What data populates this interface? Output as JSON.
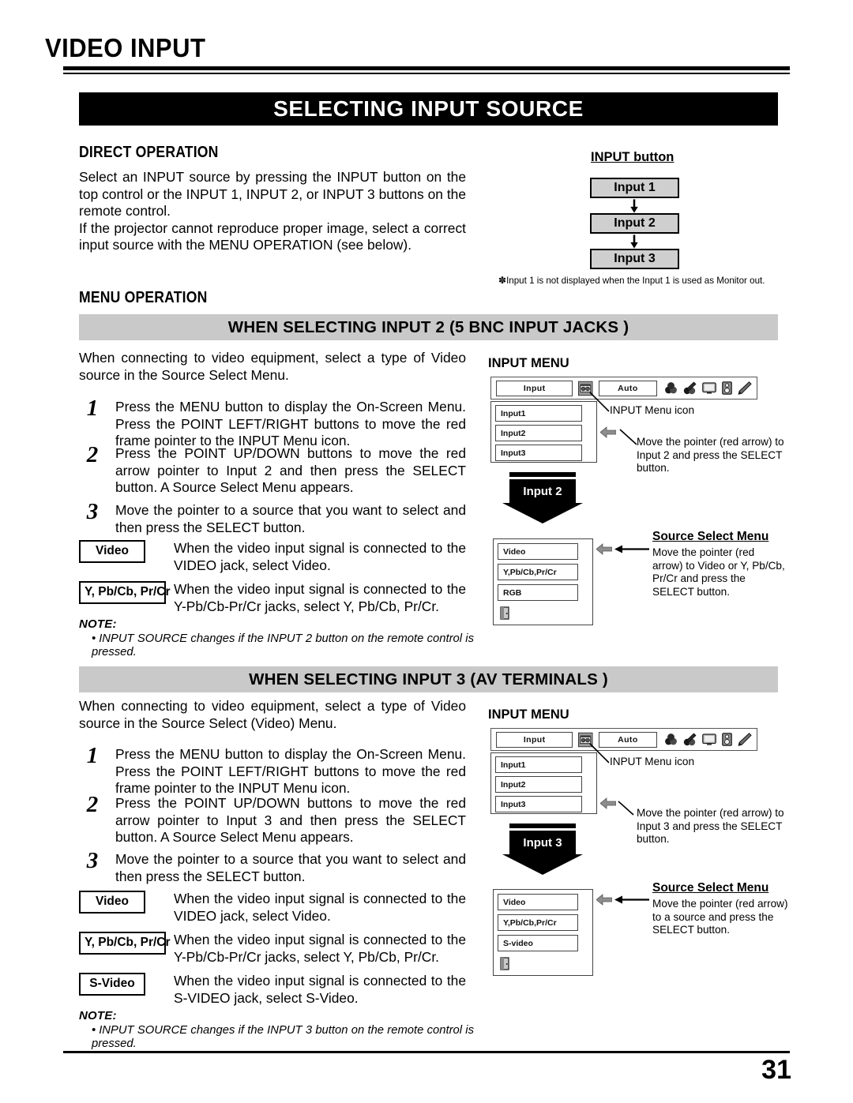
{
  "page": {
    "title": "VIDEO INPUT",
    "banner": "SELECTING INPUT SOURCE",
    "number": "31"
  },
  "direct_operation": {
    "heading": "DIRECT OPERATION",
    "paragraph1": "Select an INPUT source by pressing the INPUT button on the top control or the INPUT 1, INPUT 2, or INPUT 3 buttons on the remote control.",
    "paragraph2": "If the projector cannot reproduce proper image, select a correct input source with the MENU OPERATION (see below)."
  },
  "input_button_diagram": {
    "label": "INPUT button",
    "buttons": [
      "Input 1",
      "Input 2",
      "Input 3"
    ],
    "footnote_mark": "✽",
    "footnote": "Input 1 is not displayed when the Input 1 is used as Monitor out."
  },
  "menu_operation": {
    "heading": "MENU OPERATION"
  },
  "section_input2": {
    "bar": "WHEN SELECTING INPUT 2 (5 BNC INPUT JACKS )",
    "intro": "When connecting to video equipment, select a type of Video source in the Source Select Menu.",
    "steps": [
      {
        "num": "1",
        "text": "Press the MENU button to display the On-Screen Menu. Press the POINT LEFT/RIGHT buttons to move the red frame pointer to the INPUT Menu icon."
      },
      {
        "num": "2",
        "text": "Press the POINT UP/DOWN buttons to move the red arrow pointer to Input 2 and then press the SELECT button. A Source Select Menu appears."
      },
      {
        "num": "3",
        "text": "Move the pointer to a source that you want to select and then press the SELECT button."
      }
    ],
    "definitions": [
      {
        "key": "Video",
        "desc": "When the video input signal is connected to the VIDEO jack, select Video."
      },
      {
        "key": "Y, Pb/Cb, Pr/Cr",
        "desc": "When the video input signal is connected to the Y-Pb/Cb-Pr/Cr jacks, select Y, Pb/Cb, Pr/Cr."
      }
    ],
    "note_heading": "NOTE:",
    "note_text": "INPUT SOURCE changes if the INPUT 2 button on the remote control is pressed."
  },
  "section_input3": {
    "bar": "WHEN SELECTING INPUT 3 (AV TERMINALS )",
    "intro": "When connecting to video equipment, select a type of Video source in the Source Select (Video) Menu.",
    "steps": [
      {
        "num": "1",
        "text": "Press the MENU button to display the On-Screen Menu. Press the POINT LEFT/RIGHT buttons to move the red frame pointer to the INPUT Menu icon."
      },
      {
        "num": "2",
        "text": "Press the POINT UP/DOWN buttons to move the red arrow pointer to Input 3 and then press the SELECT button. A Source Select Menu appears."
      },
      {
        "num": "3",
        "text": "Move the pointer to a source that you want to select and then press the SELECT button."
      }
    ],
    "definitions": [
      {
        "key": "Video",
        "desc": "When the video input signal is connected to the VIDEO jack, select Video."
      },
      {
        "key": "Y, Pb/Cb, Pr/Cr",
        "desc": "When the video input signal is connected to the Y-Pb/Cb-Pr/Cr jacks, select Y, Pb/Cb, Pr/Cr."
      },
      {
        "key": "S-Video",
        "desc": "When the video input signal is connected to the S-VIDEO jack, select S-Video."
      }
    ],
    "note_heading": "NOTE:",
    "note_text": "INPUT SOURCE changes if the INPUT 3 button on the remote control is pressed."
  },
  "osd_input2": {
    "title": "INPUT MENU",
    "menu_field": "Input",
    "auto_field": "Auto",
    "icons": [
      "input-menu-icon",
      "color-adjust-icon",
      "image-adjust-icon",
      "screen-icon",
      "sound-icon",
      "setting-pencil-icon"
    ],
    "items": [
      "Input1",
      "Input2",
      "Input3"
    ],
    "pointer_on": "Input2",
    "callout_icon": "INPUT Menu icon",
    "callout_pointer": "Move the pointer (red arrow) to Input 2 and press the SELECT button.",
    "arrow_label": "Input 2",
    "source_menu_title": "Source Select Menu",
    "source_items": [
      "Video",
      "Y,Pb/Cb,Pr/Cr",
      "RGB"
    ],
    "source_pointer_on": "Video",
    "source_callout": "Move the pointer (red arrow) to Video or Y, Pb/Cb, Pr/Cr and press the SELECT button."
  },
  "osd_input3": {
    "title": "INPUT MENU",
    "menu_field": "Input",
    "auto_field": "Auto",
    "icons": [
      "input-menu-icon",
      "color-adjust-icon",
      "image-adjust-icon",
      "screen-icon",
      "sound-icon",
      "setting-pencil-icon"
    ],
    "items": [
      "Input1",
      "Input2",
      "Input3"
    ],
    "pointer_on": "Input3",
    "callout_icon": "INPUT Menu icon",
    "callout_pointer": "Move the pointer (red arrow) to Input 3 and press the SELECT button.",
    "arrow_label": "Input 3",
    "source_menu_title": "Source Select Menu",
    "source_items": [
      "Video",
      "Y,Pb/Cb,Pr/Cr",
      "S-video"
    ],
    "source_pointer_on": "Video",
    "source_callout": "Move the pointer (red arrow) to a source and press the SELECT button."
  }
}
